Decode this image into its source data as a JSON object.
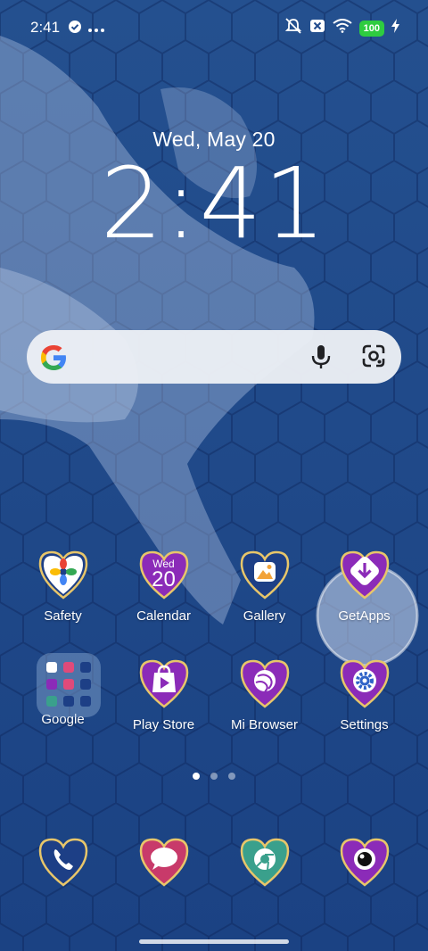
{
  "status_bar": {
    "time": "2:41",
    "battery": "100"
  },
  "lock": {
    "date": "Wed, May 20",
    "time": "2:41"
  },
  "search": {
    "google_icon": "google-g-icon",
    "mic_icon": "mic-icon",
    "lens_icon": "lens-icon"
  },
  "apps": [
    {
      "label": "Safety",
      "icon": "safety-icon"
    },
    {
      "label": "Calendar",
      "icon": "calendar-icon",
      "day": "Wed",
      "date": "20"
    },
    {
      "label": "Gallery",
      "icon": "gallery-icon"
    },
    {
      "label": "GetApps",
      "icon": "getapps-icon"
    },
    {
      "label": "Google",
      "icon": "folder-icon"
    },
    {
      "label": "Play Store",
      "icon": "play-store-icon"
    },
    {
      "label": "Mi Browser",
      "icon": "mi-browser-icon"
    },
    {
      "label": "Settings",
      "icon": "settings-icon"
    }
  ],
  "dock": [
    {
      "icon": "phone-icon"
    },
    {
      "icon": "messages-icon"
    },
    {
      "icon": "chrome-icon"
    },
    {
      "icon": "camera-icon"
    }
  ],
  "pages": {
    "count": 3,
    "active": 1
  },
  "colors": {
    "background": "#1f4a8c",
    "heart_purple": "#8b2bb8",
    "heart_navy": "#1d3f86",
    "heart_gold": "#e8c66a",
    "heart_pink": "#c83a6a",
    "heart_teal": "#3aa08c",
    "battery": "#2ecc40"
  }
}
